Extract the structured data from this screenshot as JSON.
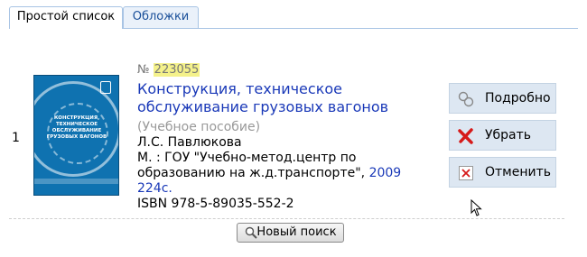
{
  "tabs": [
    {
      "label": "Простой список",
      "active": true
    },
    {
      "label": "Обложки",
      "active": false
    }
  ],
  "record": {
    "row_number": "1",
    "record_no_prefix": "№",
    "record_no": "223055",
    "title": "Конструкция, техническое обслуживание грузовых вагонов",
    "type": "(Учебное пособие)",
    "author": "Л.С. Павлюкова",
    "publisher": "М. : ГОУ \"Учебно-метод.центр по образованию на ж.д.транспорте\",",
    "year": "2009",
    "pages": "224с.",
    "isbn": "ISBN 978-5-89035-552-2",
    "cover_text": "КОНСТРУКЦИЯ, ТЕХНИЧЕСКОЕ ОБСЛУЖИВАНИЕ ГРУЗОВЫХ ВАГОНОВ"
  },
  "actions": {
    "details_label": "Подробно",
    "remove_label": "Убрать",
    "cancel_label": "Отменить"
  },
  "search": {
    "new_search_label": "Новый поиск"
  },
  "colors": {
    "link": "#1a39b8",
    "tab_border": "#a8c4e4",
    "highlight": "#f4f18a",
    "remove_icon": "#d61a1a",
    "button_bg": "#dde7f2"
  },
  "icons": {
    "details": "magnifier-circles-icon",
    "remove": "red-x-icon",
    "cancel": "boxed-x-icon",
    "search": "magnifier-icon"
  }
}
